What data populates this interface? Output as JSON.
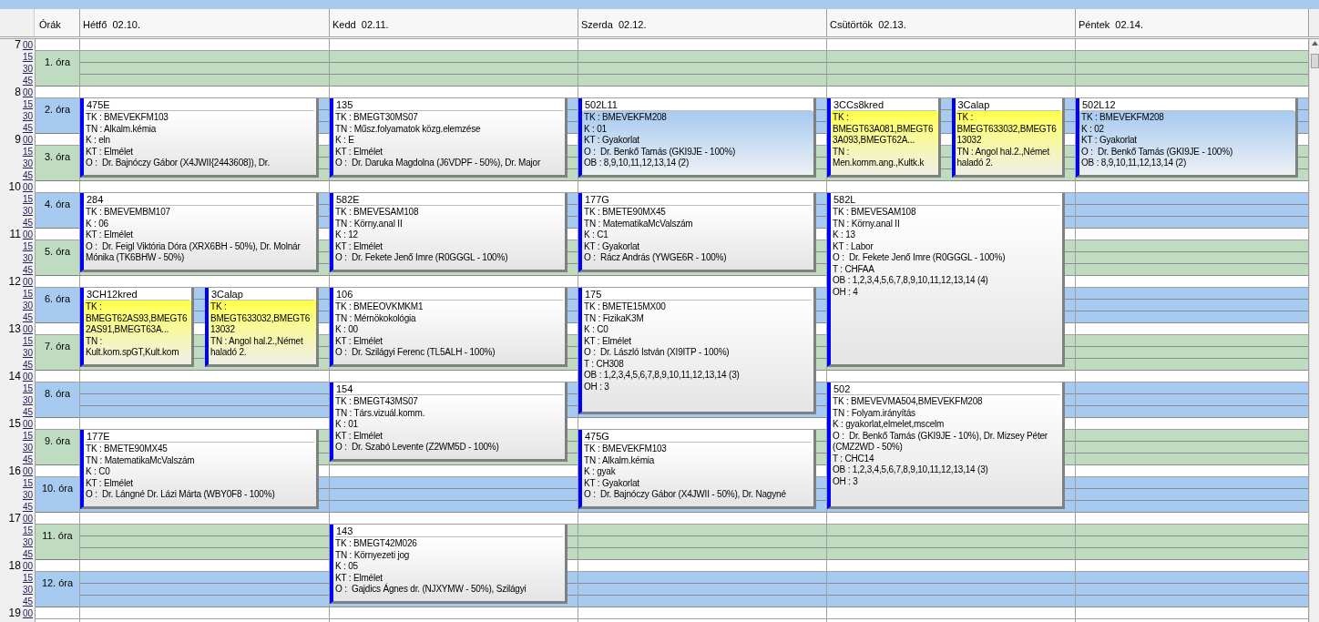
{
  "header": {
    "hours_label": "Órák",
    "days": [
      "Hétfő  02.10.",
      "Kedd  02.11.",
      "Szerda  02.12.",
      "Csütörtök  02.13.",
      "Péntek  02.14."
    ]
  },
  "hours": [
    {
      "hour": "7",
      "minutes": [
        "00",
        "15",
        "30",
        "45"
      ]
    },
    {
      "hour": "8",
      "minutes": [
        "00",
        "15",
        "30",
        "45"
      ]
    },
    {
      "hour": "9",
      "minutes": [
        "00",
        "15",
        "30",
        "45"
      ]
    },
    {
      "hour": "10",
      "minutes": [
        "00",
        "15",
        "30",
        "45"
      ]
    },
    {
      "hour": "11",
      "minutes": [
        "00",
        "15",
        "30",
        "45"
      ]
    },
    {
      "hour": "12",
      "minutes": [
        "00",
        "15",
        "30",
        "45"
      ]
    },
    {
      "hour": "13",
      "minutes": [
        "00",
        "15",
        "30",
        "45"
      ]
    },
    {
      "hour": "14",
      "minutes": [
        "00",
        "15",
        "30",
        "45"
      ]
    },
    {
      "hour": "15",
      "minutes": [
        "00",
        "15",
        "30",
        "45"
      ]
    },
    {
      "hour": "16",
      "minutes": [
        "00",
        "15",
        "30",
        "45"
      ]
    },
    {
      "hour": "17",
      "minutes": [
        "00",
        "15",
        "30",
        "45"
      ]
    },
    {
      "hour": "18",
      "minutes": [
        "00",
        "15",
        "30",
        "45"
      ]
    },
    {
      "hour": "19",
      "minutes": [
        "00"
      ]
    }
  ],
  "periods": [
    {
      "label": "1. óra",
      "color": "#c0dcc0"
    },
    {
      "label": "2. óra",
      "color": "#a6caf0"
    },
    {
      "label": "3. óra",
      "color": "#c0dcc0"
    },
    {
      "label": "4. óra",
      "color": "#a6caf0"
    },
    {
      "label": "5. óra",
      "color": "#c0dcc0"
    },
    {
      "label": "6. óra",
      "color": "#a6caf0"
    },
    {
      "label": "7. óra",
      "color": "#c0dcc0"
    },
    {
      "label": "8. óra",
      "color": "#a6caf0"
    },
    {
      "label": "9. óra",
      "color": "#c0dcc0"
    },
    {
      "label": "10. óra",
      "color": "#a6caf0"
    },
    {
      "label": "11. óra",
      "color": "#c0dcc0"
    },
    {
      "label": "12. óra",
      "color": "#a6caf0"
    }
  ],
  "schedule": [
    {
      "slots": [
        {
          "kind": "free"
        },
        {
          "kind": "event",
          "entries": [
            {
              "kind": "plain",
              "title": "475E",
              "lines": [
                "TK : BMEVEKFM103",
                "TN : Alkalm.kémia",
                "K : eln",
                "KT : Elmélet",
                "O :  Dr. Bajnóczy Gábor (X4JWII{2443608}), Dr."
              ]
            }
          ]
        },
        {
          "kind": "continued"
        },
        {
          "kind": "event",
          "entries": [
            {
              "kind": "plain",
              "title": "284",
              "lines": [
                "TK : BMEVEMBM107",
                "K : 06",
                "KT : Elmélet",
                "O :  Dr. Feigl Viktória Dóra (XRX6BH - 50%), Dr. Molnár Mónika (TK6BHW - 50%)"
              ]
            }
          ]
        },
        {
          "kind": "continued"
        },
        {
          "kind": "event",
          "entries": [
            {
              "kind": "yellow",
              "title": "3CH12kred",
              "lines": [
                "TK : BMEGT62AS93,BMEGT62AS91,BMEGT63A...",
                "TN : Kult.kom.spGT,Kult.kom"
              ]
            },
            {
              "kind": "yellow",
              "title": "3Calap",
              "lines": [
                "TK : BMEGT633032,BMEGT613032",
                "TN : Angol hal.2.,Német haladó 2."
              ]
            }
          ]
        },
        {
          "kind": "continued"
        },
        {
          "kind": "free"
        },
        {
          "kind": "event",
          "entries": [
            {
              "kind": "plain",
              "title": "177E",
              "lines": [
                "TK : BMETE90MX45",
                "TN : MatematikaMcValszám",
                "K : C0",
                "KT : Elmélet",
                "O :  Dr. Lángné Dr. Lázi Márta (WBY0F8 - 100%)"
              ]
            }
          ]
        },
        {
          "kind": "continued"
        },
        {
          "kind": "free"
        },
        {
          "kind": "free"
        }
      ]
    },
    {
      "slots": [
        {
          "kind": "free"
        },
        {
          "kind": "event",
          "entries": [
            {
              "kind": "plain",
              "title": "135",
              "lines": [
                "TK : BMEGT30MS07",
                "TN : Műsz.folyamatok közg.elemzése",
                "K : E",
                "KT : Elmélet",
                "O :  Dr. Daruka Magdolna (J6VDPF - 50%), Dr. Major"
              ]
            }
          ]
        },
        {
          "kind": "continued"
        },
        {
          "kind": "event",
          "entries": [
            {
              "kind": "plain",
              "title": "582E",
              "lines": [
                "TK : BMEVESAM108",
                "TN : Körny.anal II",
                "K : 12",
                "KT : Elmélet",
                "O :  Dr. Fekete Jenő Imre (R0GGGL - 100%)"
              ]
            }
          ]
        },
        {
          "kind": "continued"
        },
        {
          "kind": "event",
          "entries": [
            {
              "kind": "plain",
              "title": "106",
              "lines": [
                "TK : BMEEOVKMKM1",
                "TN : Mérnökokológia",
                "K : 00",
                "KT : Elmélet",
                "O :  Dr. Szilágyi Ferenc (TL5ALH - 100%)"
              ]
            }
          ]
        },
        {
          "kind": "continued"
        },
        {
          "kind": "event",
          "entries": [
            {
              "kind": "plain",
              "title": "154",
              "lines": [
                "TK : BMEGT43MS07",
                "TN : Társ.vizuál.komm.",
                "K : 01",
                "KT : Elmélet",
                "O :  Dr. Szabó Levente (Z2WM5D - 100%)"
              ]
            }
          ]
        },
        {
          "kind": "continued"
        },
        {
          "kind": "free"
        },
        {
          "kind": "event",
          "entries": [
            {
              "kind": "plain",
              "title": "143",
              "lines": [
                "TK : BMEGT42M026",
                "TN : Környezeti jog",
                "K : 05",
                "KT : Elmélet",
                "O :  Gajdics Ágnes dr. (NJXYMW - 50%), Szilágyi"
              ]
            }
          ]
        },
        {
          "kind": "continued"
        }
      ]
    },
    {
      "slots": [
        {
          "kind": "free"
        },
        {
          "kind": "event",
          "entries": [
            {
              "kind": "blue",
              "title": "502L11",
              "lines": [
                "TK : BMEVEKFM208",
                "K : 01",
                "KT : Gyakorlat",
                "O :  Dr. Benkő Tamás (GKI9JE - 100%)",
                "OB : 8,9,10,11,12,13,14 (2)"
              ]
            }
          ]
        },
        {
          "kind": "continued"
        },
        {
          "kind": "event",
          "entries": [
            {
              "kind": "plain",
              "title": "177G",
              "lines": [
                "TK : BMETE90MX45",
                "TN : MatematikaMcValszám",
                "K : C1",
                "KT : Gyakorlat",
                "O :  Rácz András (YWGE6R - 100%)"
              ]
            }
          ]
        },
        {
          "kind": "continued"
        },
        {
          "kind": "event",
          "entries": [
            {
              "kind": "plain",
              "title": "175",
              "lines": [
                "TK : BMETE15MX00",
                "TN : FizikaK3M",
                "K : C0",
                "KT : Elmélet",
                "O :  Dr. László István (XI9ITP - 100%)",
                "T : CH308",
                "OB : 1,2,3,4,5,6,7,8,9,10,11,12,13,14 (3)",
                "OH : 3"
              ]
            }
          ]
        },
        {
          "kind": "continued"
        },
        {
          "kind": "continued"
        },
        {
          "kind": "event",
          "entries": [
            {
              "kind": "plain",
              "title": "475G",
              "lines": [
                "TK : BMEVEKFM103",
                "TN : Alkalm.kémia",
                "K : gyak",
                "KT : Gyakorlat",
                "O :  Dr. Bajnóczy Gábor (X4JWII - 50%), Dr. Nagyné"
              ]
            }
          ]
        },
        {
          "kind": "continued"
        },
        {
          "kind": "free"
        },
        {
          "kind": "free"
        }
      ]
    },
    {
      "slots": [
        {
          "kind": "free"
        },
        {
          "kind": "event",
          "entries": [
            {
              "kind": "yellow",
              "title": "3CCs8kred",
              "lines": [
                "TK : BMEGT63A081,BMEGT63A093,BMEGT62A...",
                "TN : Men.komm.ang.,Kultk.k"
              ]
            },
            {
              "kind": "yellow",
              "title": "3Calap",
              "lines": [
                "TK : BMEGT633032,BMEGT613032",
                "TN : Angol hal.2.,Német haladó 2."
              ]
            }
          ]
        },
        {
          "kind": "continued"
        },
        {
          "kind": "event",
          "entries": [
            {
              "kind": "plain",
              "title": "582L",
              "lines": [
                "TK : BMEVESAM108",
                "TN : Körny.anal II",
                "K : 13",
                "KT : Labor",
                "O :  Dr. Fekete Jenő Imre (R0GGGL - 100%)",
                "T : CHFAA",
                "OB : 1,2,3,4,5,6,7,8,9,10,11,12,13,14 (4)",
                "OH : 4"
              ]
            }
          ]
        },
        {
          "kind": "continued"
        },
        {
          "kind": "continued"
        },
        {
          "kind": "continued"
        },
        {
          "kind": "event",
          "entries": [
            {
              "kind": "plain",
              "title": "502",
              "lines": [
                "TK : BMEVEVMA504,BMEVEKFM208",
                "TN : Folyam.irányítás",
                "K : gyakorlat,elmelet,mscelm",
                "O :  Dr. Benkő Tamás (GKI9JE - 10%), Dr. Mizsey Péter (CMZ2WD - 50%)",
                "T : CHC14",
                "OB : 1,2,3,4,5,6,7,8,9,10,11,12,13,14 (3)",
                "OH : 3"
              ]
            }
          ]
        },
        {
          "kind": "continued"
        },
        {
          "kind": "continued"
        },
        {
          "kind": "free"
        },
        {
          "kind": "free"
        }
      ]
    },
    {
      "slots": [
        {
          "kind": "free"
        },
        {
          "kind": "event",
          "entries": [
            {
              "kind": "blue",
              "title": "502L12",
              "lines": [
                "TK : BMEVEKFM208",
                "K : 02",
                "KT : Gyakorlat",
                "O :  Dr. Benkő Tamás (GKI9JE - 100%)",
                "OB : 8,9,10,11,12,13,14 (2)"
              ]
            }
          ]
        },
        {
          "kind": "continued"
        },
        {
          "kind": "free"
        },
        {
          "kind": "free"
        },
        {
          "kind": "free"
        },
        {
          "kind": "free"
        },
        {
          "kind": "free"
        },
        {
          "kind": "free"
        },
        {
          "kind": "free"
        },
        {
          "kind": "free"
        },
        {
          "kind": "free"
        }
      ]
    }
  ]
}
